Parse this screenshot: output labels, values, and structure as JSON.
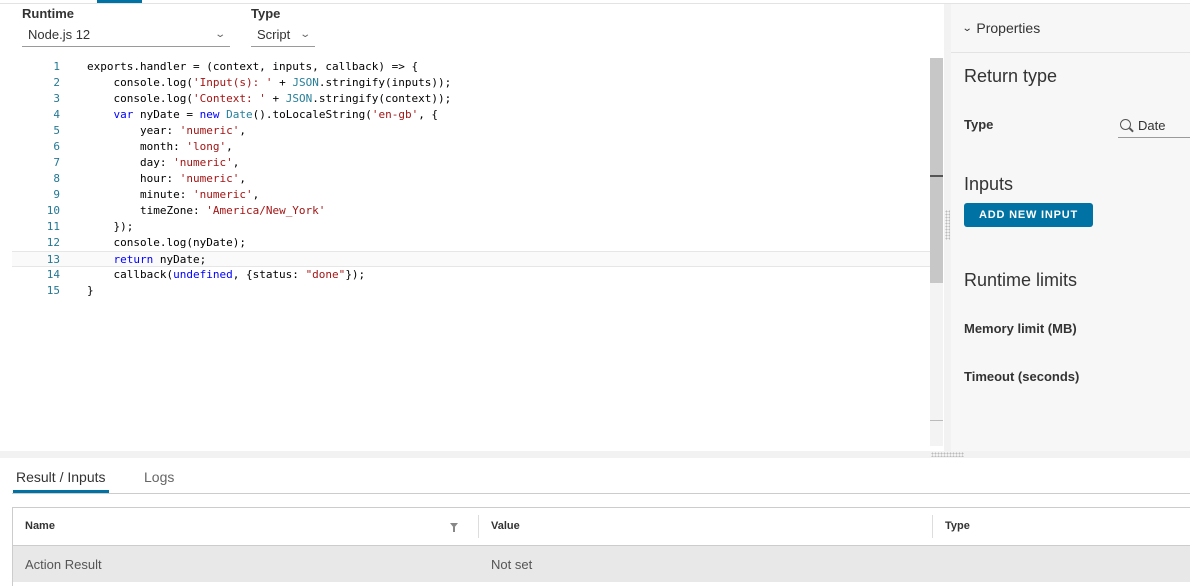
{
  "selectors": {
    "runtime": {
      "label": "Runtime",
      "value": "Node.js 12"
    },
    "type": {
      "label": "Type",
      "value": "Script"
    }
  },
  "editor": {
    "lines": [
      {
        "n": "1",
        "code": "exports.handler = (context, inputs, callback) => {"
      },
      {
        "n": "2",
        "code": "    console.log('Input(s): ' + JSON.stringify(inputs));"
      },
      {
        "n": "3",
        "code": "    console.log('Context: ' + JSON.stringify(context));"
      },
      {
        "n": "4",
        "code": "    var nyDate = new Date().toLocaleString('en-gb', {"
      },
      {
        "n": "5",
        "code": "        year: 'numeric',"
      },
      {
        "n": "6",
        "code": "        month: 'long',"
      },
      {
        "n": "7",
        "code": "        day: 'numeric',"
      },
      {
        "n": "8",
        "code": "        hour: 'numeric',"
      },
      {
        "n": "9",
        "code": "        minute: 'numeric',"
      },
      {
        "n": "10",
        "code": "        timeZone: 'America/New_York'"
      },
      {
        "n": "11",
        "code": "    });"
      },
      {
        "n": "12",
        "code": "    console.log(nyDate);"
      },
      {
        "n": "13",
        "code": "    return nyDate;"
      },
      {
        "n": "14",
        "code": "    callback(undefined, {status: \"done\"});"
      },
      {
        "n": "15",
        "code": "}"
      }
    ],
    "active_line": "13"
  },
  "properties": {
    "header": "Properties",
    "return_type_heading": "Return type",
    "type_label": "Type",
    "type_value": "Date",
    "inputs_heading": "Inputs",
    "add_input_button": "ADD NEW INPUT",
    "runtime_limits_heading": "Runtime limits",
    "memory_label": "Memory limit (MB)",
    "timeout_label": "Timeout (seconds)"
  },
  "bottom": {
    "tabs": [
      {
        "label": "Result / Inputs",
        "active": true
      },
      {
        "label": "Logs",
        "active": false
      }
    ],
    "table": {
      "columns": [
        "Name",
        "Value",
        "Type"
      ],
      "rows": [
        {
          "name": "Action Result",
          "value": "Not set",
          "type": ""
        }
      ]
    }
  },
  "colors": {
    "accent": "#0072a3",
    "line_number": "#237893",
    "string": "#a31515",
    "keyword": "#0000ff",
    "type": "#267f99"
  },
  "icons": {
    "dropdown": "chevron-down-icon",
    "search": "search-icon",
    "filter": "filter-icon"
  }
}
